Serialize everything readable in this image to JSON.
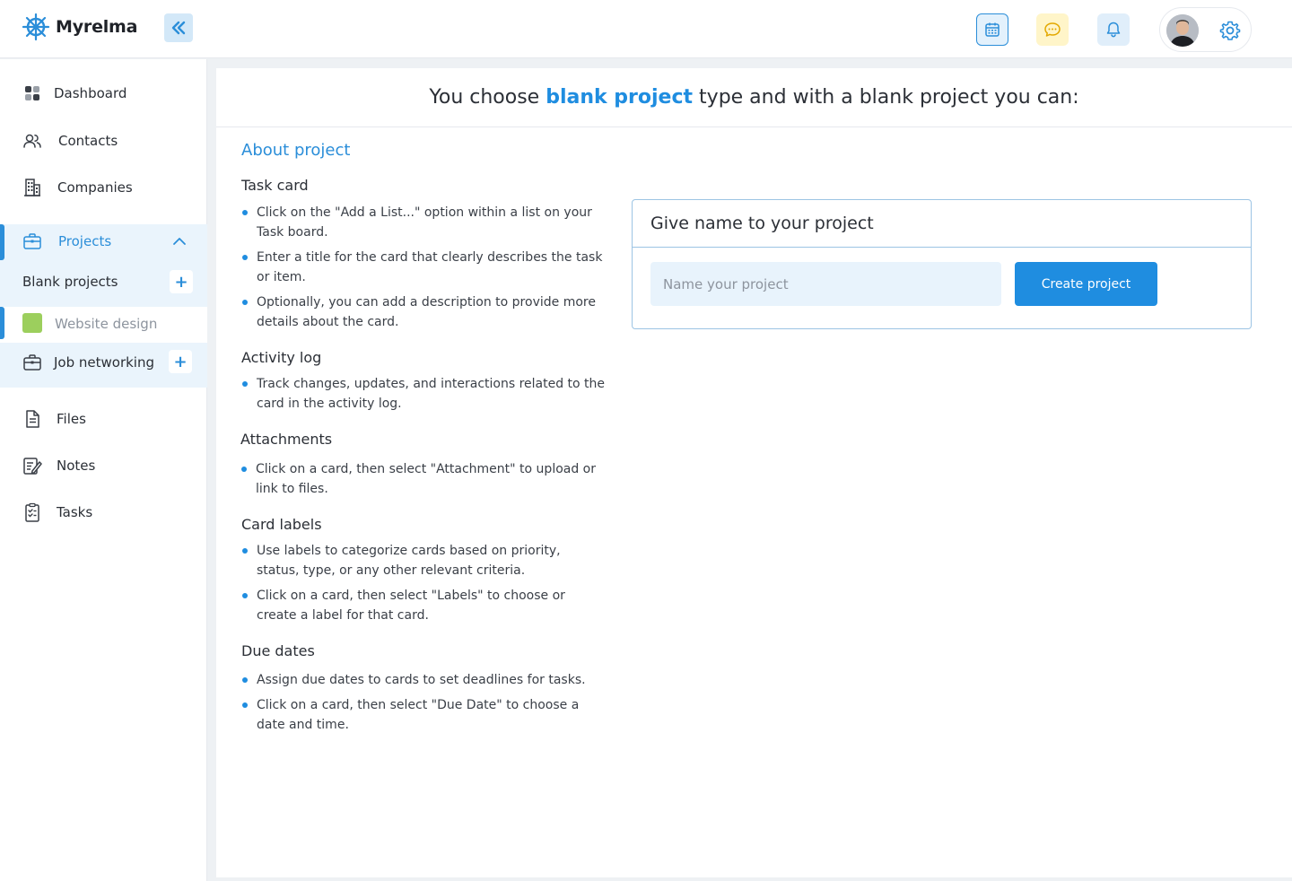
{
  "app": {
    "name": "Myrelma"
  },
  "header": {
    "icons": [
      "calendar-icon",
      "chat-icon",
      "bell-icon",
      "gear-icon"
    ]
  },
  "sidebar": {
    "items": [
      {
        "label": "Dashboard",
        "icon": "dashboard-icon"
      },
      {
        "label": "Contacts",
        "icon": "contacts-icon"
      },
      {
        "label": "Companies",
        "icon": "building-icon"
      },
      {
        "label": "Projects",
        "icon": "briefcase-icon"
      },
      {
        "label": "Files",
        "icon": "file-icon"
      },
      {
        "label": "Notes",
        "icon": "notes-icon"
      },
      {
        "label": "Tasks",
        "icon": "tasks-icon"
      }
    ],
    "projects": {
      "blank_projects_label": "Blank projects",
      "website_design_label": "Website design",
      "website_design_color": "#9ccf5d",
      "job_networking_label": "Job networking",
      "plus": "+"
    }
  },
  "main": {
    "title_prefix": "You choose",
    "title_highlight": "blank project",
    "title_suffix": "type and with a blank project you can:",
    "about_title": "About project",
    "sections": [
      {
        "heading": "Task card",
        "bullets": [
          "Click on the \"Add a List...\" option within a list on your Task board.",
          "Enter a title for the card that clearly describes the task or item.",
          "Optionally, you can add a description to provide more details about the card."
        ]
      },
      {
        "heading": "Activity log",
        "bullets": [
          "Track changes, updates, and interactions related to the card in the activity log."
        ]
      },
      {
        "heading": "Attachments",
        "bullets": [
          "Click on a card, then select \"Attachment\" to upload or link to files."
        ]
      },
      {
        "heading": "Card labels",
        "bullets": [
          "Use labels to categorize cards based on priority, status, type, or any other relevant criteria.",
          "Click on a card, then select \"Labels\" to choose or create a label for that card."
        ]
      },
      {
        "heading": "Due dates",
        "bullets": [
          "Assign due dates to cards to set deadlines for tasks.",
          "Click on a card, then select \"Due Date\" to choose a date and time."
        ]
      }
    ],
    "form": {
      "title": "Give name to your project",
      "input_placeholder": "Name your project",
      "input_value": "",
      "submit_label": "Create project"
    }
  },
  "colors": {
    "accent": "#1f8de0",
    "active_bg": "#eaf4fc"
  }
}
